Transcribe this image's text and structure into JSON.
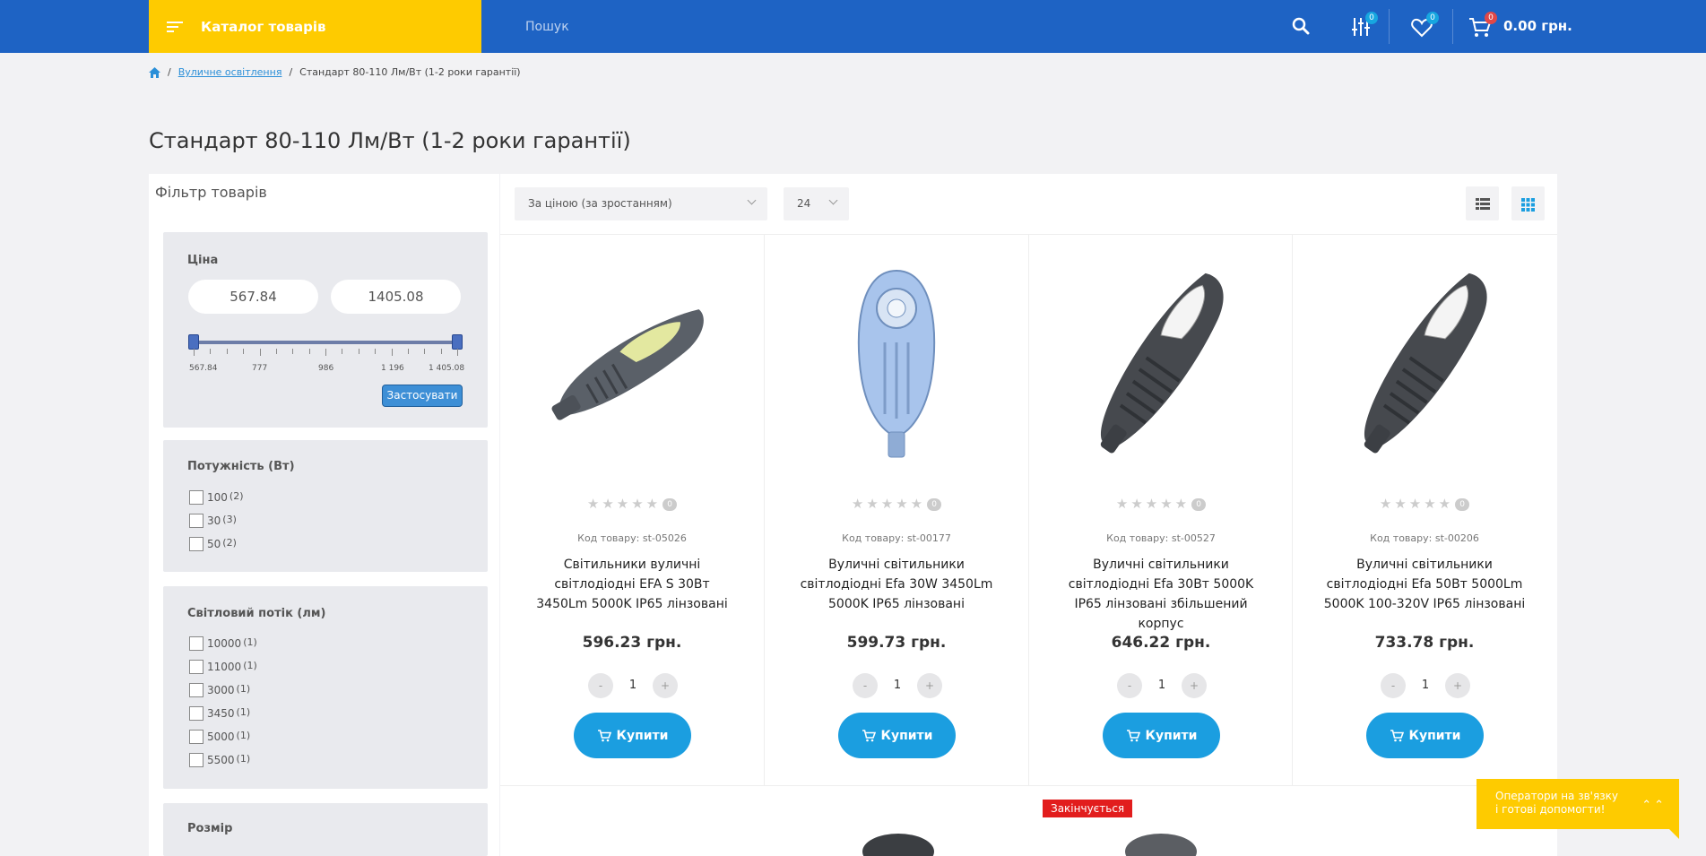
{
  "header": {
    "catalog_label": "Каталог товарів",
    "search_placeholder": "Пошук",
    "compare_count": "0",
    "wishlist_count": "0",
    "cart_count": "0",
    "cart_total": "0.00 грн.",
    "colors": {
      "blue": "#1e63c4",
      "yellow": "#fecb00"
    }
  },
  "breadcrumb": {
    "home_icon": "home-icon",
    "category": "Вуличне освітлення",
    "current": "Стандарт 80-110 Лм/Вт (1-2 роки гарантії)"
  },
  "page_title": "Стандарт 80-110 Лм/Вт (1-2 роки гарантії)",
  "filter": {
    "title": "Фільтр товарів",
    "price": {
      "label": "Ціна",
      "min": "567.84",
      "max": "1405.08",
      "tick_labels": [
        "567.84",
        "777",
        "986",
        "1 196",
        "1 405.08"
      ],
      "apply_label": "Застосувати"
    },
    "power": {
      "label": "Потужність (Вт)",
      "options": [
        {
          "value": "100",
          "count": "(2)"
        },
        {
          "value": "30",
          "count": "(3)"
        },
        {
          "value": "50",
          "count": "(2)"
        }
      ]
    },
    "flux": {
      "label": "Світловий потік (лм)",
      "options": [
        {
          "value": "10000",
          "count": "(1)"
        },
        {
          "value": "11000",
          "count": "(1)"
        },
        {
          "value": "3000",
          "count": "(1)"
        },
        {
          "value": "3450",
          "count": "(1)"
        },
        {
          "value": "5000",
          "count": "(1)"
        },
        {
          "value": "5500",
          "count": "(1)"
        }
      ]
    },
    "size": {
      "label": "Розмір"
    }
  },
  "toolbar": {
    "sort_value": "За ціною (за зростанням)",
    "per_page_value": "24"
  },
  "products": [
    {
      "code": "Код товару: st-05026",
      "name": "Світильники вуличні світлодіодні EFA S 30Вт 3450Lm 5000K IP65 лінзовані",
      "price": "596.23 грн.",
      "reviews": "0",
      "qty": "1",
      "buy": "Купити",
      "minus": "-",
      "plus": "+"
    },
    {
      "code": "Код товару: st-00177",
      "name": "Вуличні світильники світлодіодні Efa 30W 3450Lm 5000K IP65 лінзовані",
      "price": "599.73 грн.",
      "reviews": "0",
      "qty": "1",
      "buy": "Купити",
      "minus": "-",
      "plus": "+"
    },
    {
      "code": "Код товару: st-00527",
      "name": "Вуличні світильники світлодіодні Efa 30Вт 5000K IP65 лінзовані збільшений корпус",
      "price": "646.22 грн.",
      "reviews": "0",
      "qty": "1",
      "buy": "Купити",
      "minus": "-",
      "plus": "+"
    },
    {
      "code": "Код товару: st-00206",
      "name": "Вуличні світильники світлодіодні Efa 50Вт 5000Lm 5000K 100-320V IP65 лінзовані",
      "price": "733.78 грн.",
      "reviews": "0",
      "qty": "1",
      "buy": "Купити",
      "minus": "-",
      "plus": "+"
    }
  ],
  "next_row": {
    "badge": "Закінчується"
  },
  "chat": {
    "text_line1": "Оператори на зв'язку",
    "text_line2": "і готові допомогти!",
    "arrows": "⌃⌃"
  }
}
